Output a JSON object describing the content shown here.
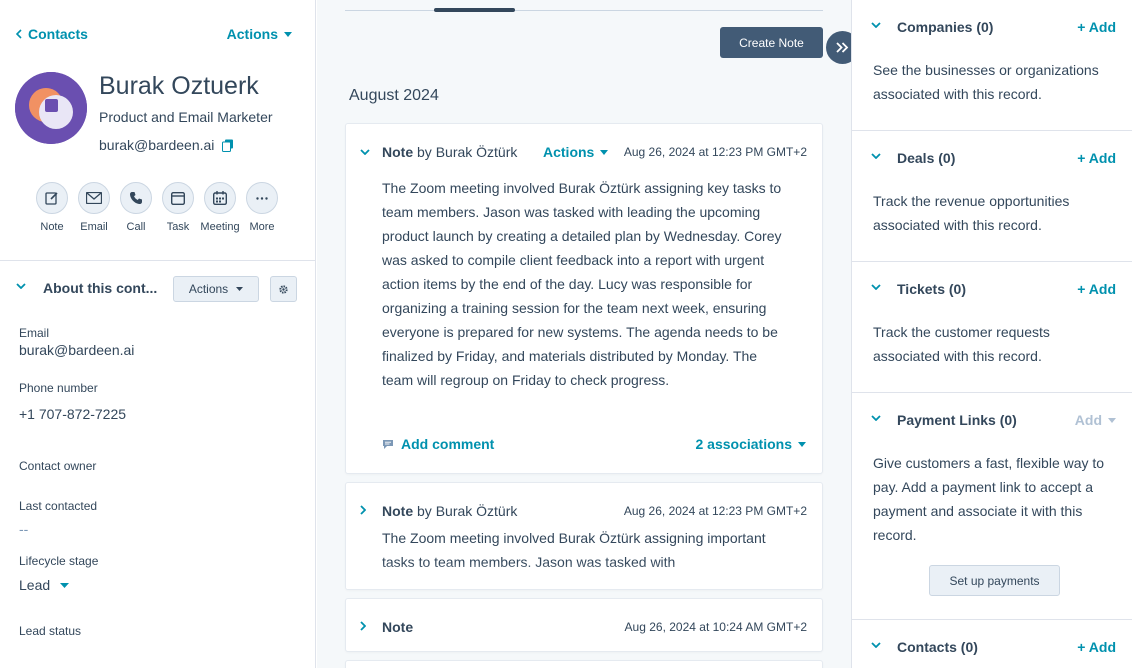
{
  "nav": {
    "back_label": "Contacts",
    "actions_label": "Actions"
  },
  "contact": {
    "name": "Burak Oztuerk",
    "title": "Product and Email Marketer",
    "email": "burak@bardeen.ai"
  },
  "quick_actions": [
    "Note",
    "Email",
    "Call",
    "Task",
    "Meeting",
    "More"
  ],
  "about": {
    "title": "About this cont...",
    "actions_label": "Actions",
    "fields": {
      "email_label": "Email",
      "email_value": "burak@bardeen.ai",
      "phone_label": "Phone number",
      "phone_value": "+1 707-872-7225",
      "owner_label": "Contact owner",
      "last_contacted_label": "Last contacted",
      "last_contacted_value": "--",
      "lifecycle_label": "Lifecycle stage",
      "lifecycle_value": "Lead",
      "lead_status_label": "Lead status"
    }
  },
  "timeline": {
    "create_note_label": "Create Note",
    "month": "August 2024",
    "notes": [
      {
        "type": "Note",
        "by": "by Burak Öztürk",
        "actions_label": "Actions",
        "timestamp": "Aug 26, 2024 at 12:23 PM GMT+2",
        "body": "The Zoom meeting involved Burak Öztürk assigning key tasks to team members. Jason was tasked with leading the upcoming product launch by creating a detailed plan by Wednesday. Corey was asked to compile client feedback into a report with urgent action items by the end of the day. Lucy was responsible for organizing a training session for the team next week, ensuring everyone is prepared for new systems. The agenda needs to be finalized by Friday, and materials distributed by Monday. The team will regroup on Friday to check progress.",
        "add_comment_label": "Add comment",
        "associations_label": "2 associations"
      },
      {
        "type": "Note",
        "by": "by Burak Öztürk",
        "timestamp": "Aug 26, 2024 at 12:23 PM GMT+2",
        "body": "The Zoom meeting involved Burak Öztürk assigning important tasks to team members. Jason was tasked with"
      },
      {
        "type": "Note",
        "timestamp": "Aug 26, 2024 at 10:24 AM GMT+2"
      }
    ]
  },
  "sidebar": {
    "companies": {
      "title": "Companies (0)",
      "add_label": "+ Add",
      "description": "See the businesses or organizations associated with this record."
    },
    "deals": {
      "title": "Deals (0)",
      "add_label": "+ Add",
      "description": "Track the revenue opportunities associated with this record."
    },
    "tickets": {
      "title": "Tickets (0)",
      "add_label": "+ Add",
      "description": "Track the customer requests associated with this record."
    },
    "payment_links": {
      "title": "Payment Links (0)",
      "add_label": "Add",
      "description": "Give customers a fast, flexible way to pay. Add a payment link to accept a payment and associate it with this record.",
      "setup_label": "Set up payments"
    },
    "contacts": {
      "title": "Contacts (0)",
      "add_label": "+ Add"
    }
  },
  "colors": {
    "accent": "#0091ae",
    "dark_button": "#425b76",
    "text": "#33475b",
    "avatar": "#6a4fb0"
  }
}
